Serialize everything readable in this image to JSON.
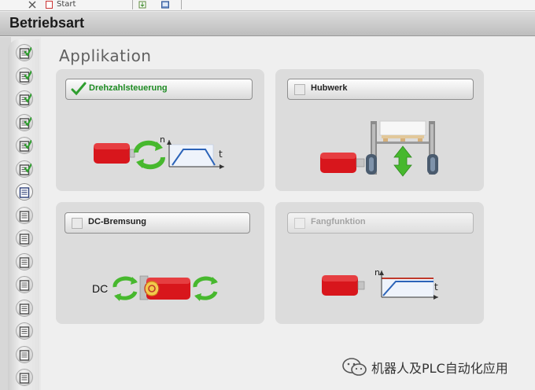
{
  "window": {
    "title": "Betriebsart"
  },
  "toolbar": {
    "text_fragment": "Start"
  },
  "section": {
    "title": "Applikation"
  },
  "options": [
    {
      "label": "Drehzahlsteuerung",
      "checked": true,
      "enabled": true
    },
    {
      "label": "Hubwerk",
      "checked": false,
      "enabled": true
    },
    {
      "label": "DC-Bremsung",
      "checked": false,
      "enabled": true
    },
    {
      "label": "Fangfunktion",
      "checked": false,
      "enabled": false
    }
  ],
  "illustrations": {
    "speed_axis_label": "n",
    "time_axis_label": "t",
    "dc_label": "DC"
  },
  "sidebar": {
    "items": [
      {
        "state": "done"
      },
      {
        "state": "done"
      },
      {
        "state": "done"
      },
      {
        "state": "done"
      },
      {
        "state": "done"
      },
      {
        "state": "done"
      },
      {
        "state": "active"
      },
      {
        "state": "pending"
      },
      {
        "state": "pending"
      },
      {
        "state": "pending"
      },
      {
        "state": "pending"
      },
      {
        "state": "pending"
      },
      {
        "state": "pending"
      },
      {
        "state": "pending"
      },
      {
        "state": "pending"
      }
    ]
  },
  "watermark": {
    "text": "机器人及PLC自动化应用"
  },
  "colors": {
    "check_green": "#2f9e2f",
    "motor_red": "#d8161c",
    "arrow_green": "#47b82e",
    "curve_blue": "#2b63b8"
  }
}
